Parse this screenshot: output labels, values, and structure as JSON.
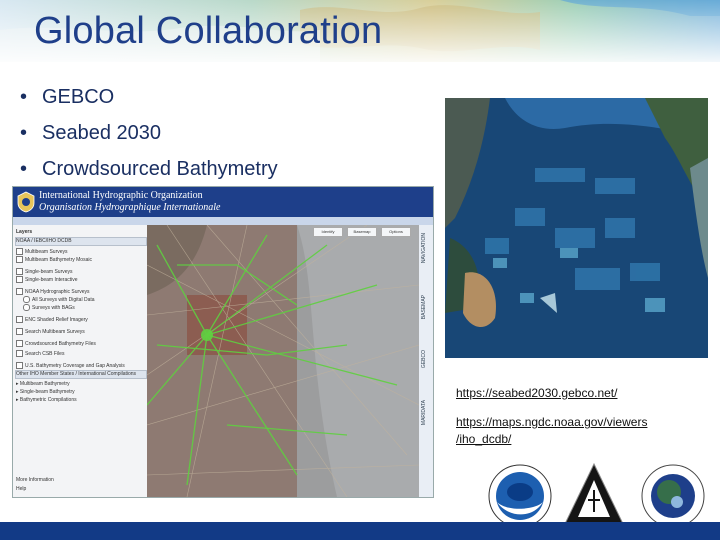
{
  "slide": {
    "title": "Global Collaboration",
    "bullets": [
      "GEBCO",
      "Seabed 2030",
      "Crowdsourced Bathymetry"
    ],
    "links": [
      "https://seabed2030.gebco.net/",
      "https://maps.ngdc.noaa.gov/viewers",
      "/iho_dcdb/"
    ],
    "colors": {
      "title": "#1f3f8a",
      "footer": "#123a86"
    }
  },
  "viewer": {
    "org_name_en": "International Hydrographic Organization",
    "org_name_fr": "Organisation Hydrographique Internationale",
    "layers_header": "Layers",
    "layer_rows": [
      "NOAA / IEBC/IHO DCDB",
      "Multibeam Surveys",
      "Multibeam Bathymetry Mosaic",
      "Single-beam Surveys",
      "Single-beam Interactive",
      "NOAA Hydrographic Surveys",
      "All Surveys with Digital Data",
      "Surveys with BAGs",
      "ENC Shaded Relief Imagery",
      "Search Multibeam Surveys",
      "Crowdsourced Bathymetry Files",
      "Search CSB Files",
      "U.S. Bathymetry Coverage and Gap Analysis",
      "Other IHO Member States / International Compilations",
      "Multibeam Bathymetry",
      "Single-beam Bathymetry",
      "Bathymetric Compilations",
      "More Information",
      "Help"
    ],
    "toolbar": [
      "Identify",
      "Basemap",
      "Options"
    ],
    "side_tabs": [
      "NAVIGATION",
      "BASEMAP",
      "GEBCO",
      "MARIDATA"
    ]
  },
  "logos": [
    "noaa-logo",
    "iho-logo",
    "ihodcdb-globe-logo"
  ]
}
